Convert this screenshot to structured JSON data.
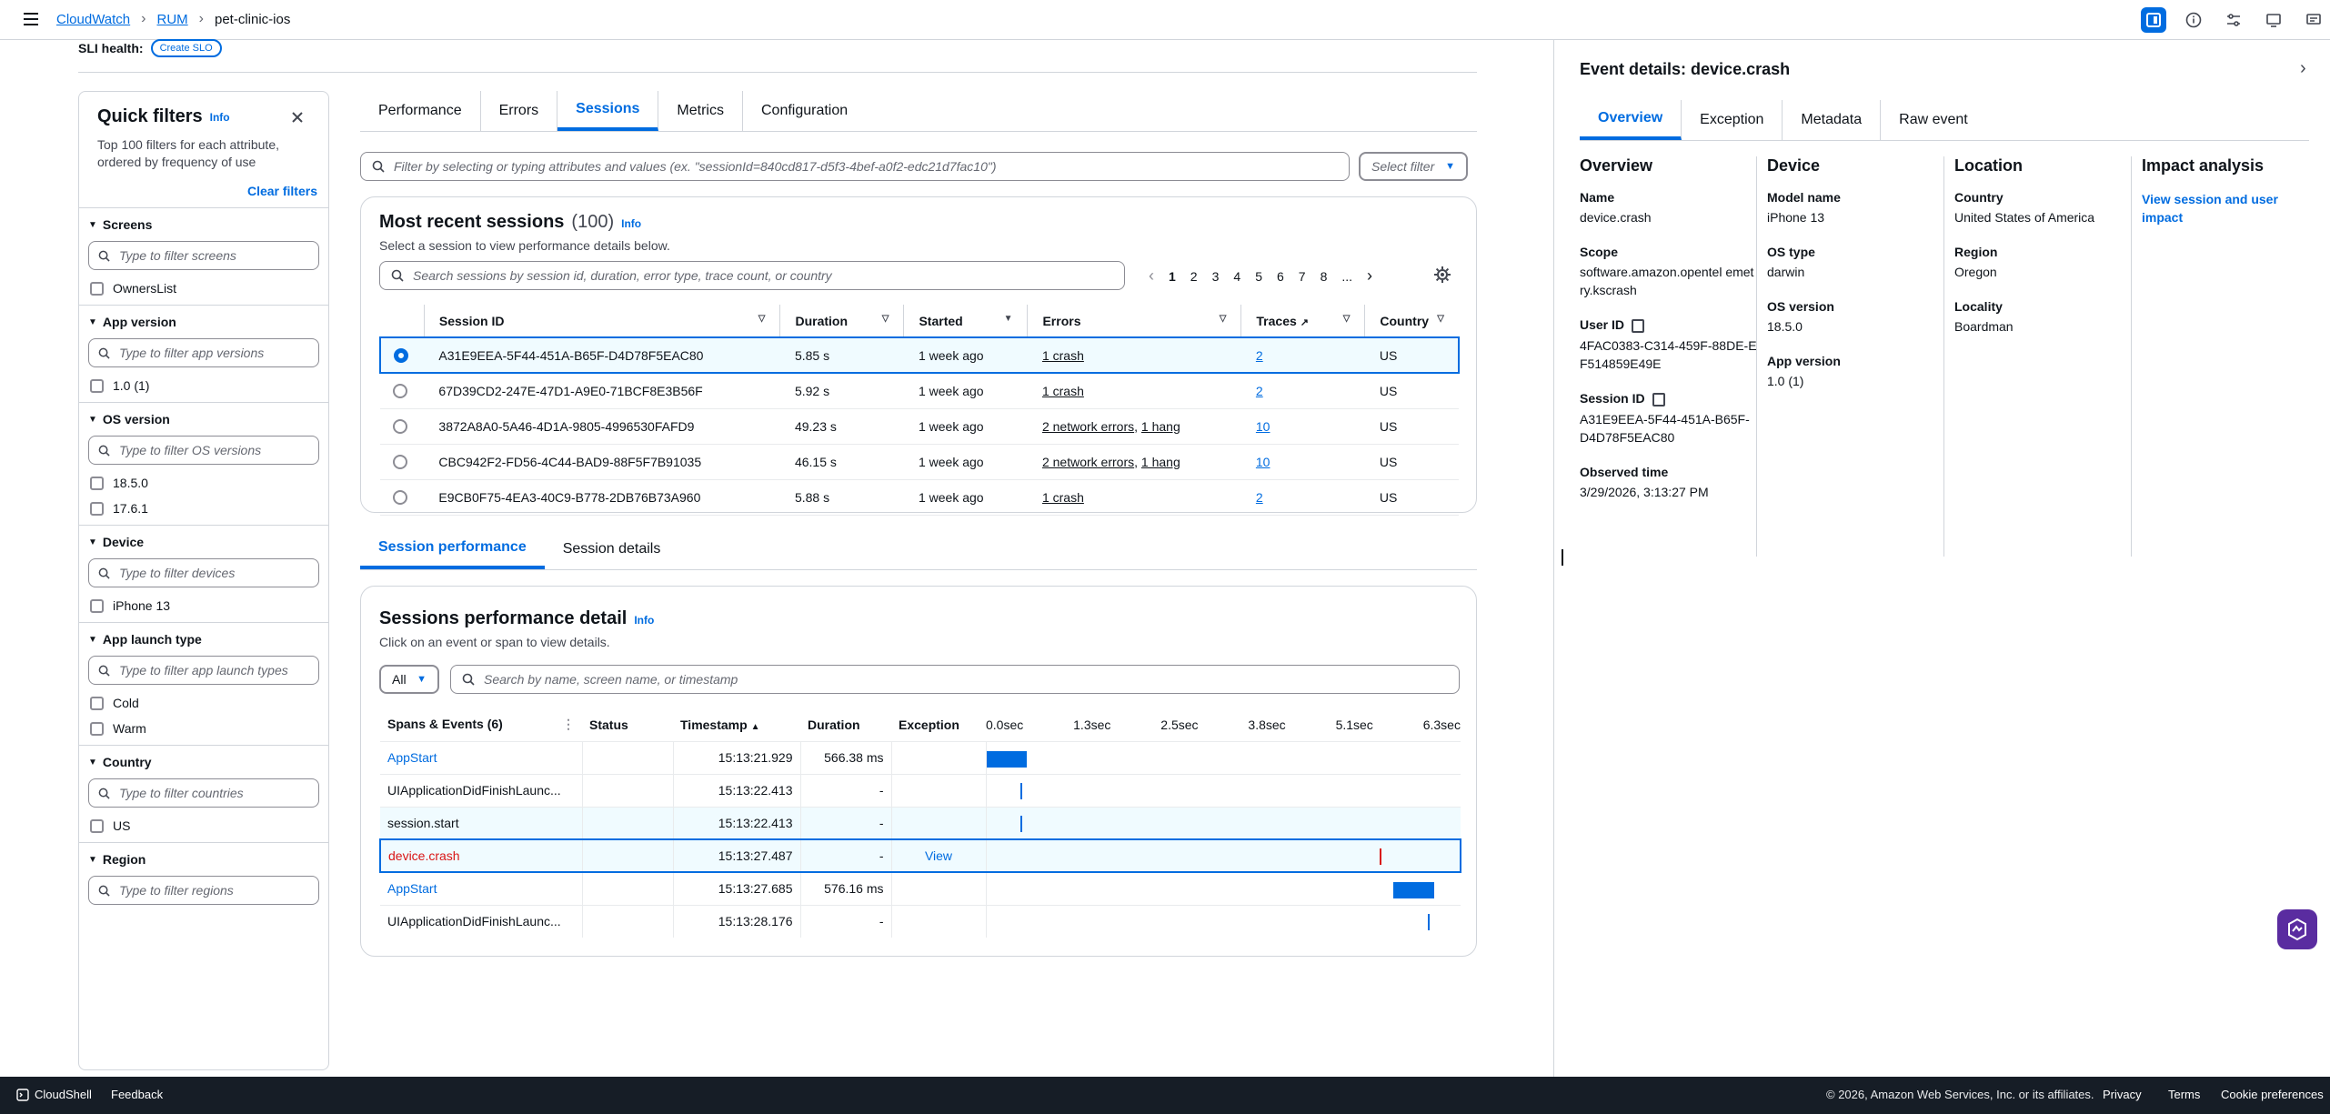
{
  "breadcrumbs": [
    "CloudWatch",
    "RUM",
    "pet-clinic-ios"
  ],
  "sli": {
    "label": "SLI health:",
    "button": "Create SLO"
  },
  "quick_filters": {
    "title": "Quick filters",
    "info": "Info",
    "description": "Top 100 filters for each attribute, ordered by frequency of use",
    "clear": "Clear filters",
    "sections": [
      {
        "title": "Screens",
        "placeholder": "Type to filter screens",
        "options": [
          "OwnersList"
        ]
      },
      {
        "title": "App version",
        "placeholder": "Type to filter app versions",
        "options": [
          "1.0 (1)"
        ]
      },
      {
        "title": "OS version",
        "placeholder": "Type to filter OS versions",
        "options": [
          "18.5.0",
          "17.6.1"
        ]
      },
      {
        "title": "Device",
        "placeholder": "Type to filter devices",
        "options": [
          "iPhone 13"
        ]
      },
      {
        "title": "App launch type",
        "placeholder": "Type to filter app launch types",
        "options": [
          "Cold",
          "Warm"
        ]
      },
      {
        "title": "Country",
        "placeholder": "Type to filter countries",
        "options": [
          "US"
        ]
      },
      {
        "title": "Region",
        "placeholder": "Type to filter regions",
        "options": []
      }
    ]
  },
  "main_tabs": [
    "Performance",
    "Errors",
    "Sessions",
    "Metrics",
    "Configuration"
  ],
  "filter": {
    "placeholder": "Filter by selecting or typing attributes and values (ex. \"sessionId=840cd817-d5f3-4bef-a0f2-edc21d7fac10\")",
    "select": "Select filter"
  },
  "sessions": {
    "title": "Most recent sessions",
    "count": "(100)",
    "info": "Info",
    "subtitle": "Select a session to view performance details below.",
    "search_placeholder": "Search sessions by session id, duration, error type, trace count, or country",
    "pages": [
      "1",
      "2",
      "3",
      "4",
      "5",
      "6",
      "7",
      "8",
      "..."
    ],
    "columns": [
      "Session ID",
      "Duration",
      "Started",
      "Errors",
      "Traces",
      "Country"
    ],
    "rows": [
      {
        "id": "A31E9EEA-5F44-451A-B65F-D4D78F5EAC80",
        "duration": "5.85 s",
        "started": "1 week ago",
        "errors": [
          "1 crash"
        ],
        "traces": "2",
        "country": "US"
      },
      {
        "id": "67D39CD2-247E-47D1-A9E0-71BCF8E3B56F",
        "duration": "5.92 s",
        "started": "1 week ago",
        "errors": [
          "1 crash"
        ],
        "traces": "2",
        "country": "US"
      },
      {
        "id": "3872A8A0-5A46-4D1A-9805-4996530FAFD9",
        "duration": "49.23 s",
        "started": "1 week ago",
        "errors": [
          "2 network errors",
          "1 hang"
        ],
        "traces": "10",
        "country": "US"
      },
      {
        "id": "CBC942F2-FD56-4C44-BAD9-88F5F7B91035",
        "duration": "46.15 s",
        "started": "1 week ago",
        "errors": [
          "2 network errors",
          "1 hang"
        ],
        "traces": "10",
        "country": "US"
      },
      {
        "id": "E9CB0F75-4EA3-40C9-B778-2DB76B73A960",
        "duration": "5.88 s",
        "started": "1 week ago",
        "errors": [
          "1 crash"
        ],
        "traces": "2",
        "country": "US"
      }
    ]
  },
  "session_tabs": [
    "Session performance",
    "Session details"
  ],
  "perf": {
    "title": "Sessions performance detail",
    "info": "Info",
    "subtitle": "Click on an event or span to view details.",
    "all": "All",
    "search_placeholder": "Search by name, screen name, or timestamp",
    "columns": [
      "Spans & Events (6)",
      "Status",
      "Timestamp",
      "Duration",
      "Exception"
    ],
    "ticks": [
      "0.0sec",
      "1.3sec",
      "2.5sec",
      "3.8sec",
      "5.1sec",
      "6.3sec"
    ],
    "rows": [
      {
        "name": "AppStart",
        "link": true,
        "crash": false,
        "timestamp": "15:13:21.929",
        "duration": "566.38 ms",
        "exception": "",
        "start": 0.0,
        "length": 0.566
      },
      {
        "name": "UIApplicationDidFinishLaunc...",
        "link": false,
        "crash": false,
        "timestamp": "15:13:22.413",
        "duration": "-",
        "exception": "",
        "start": 0.484,
        "length": 0
      },
      {
        "name": "session.start",
        "link": false,
        "crash": false,
        "timestamp": "15:13:22.413",
        "duration": "-",
        "exception": "",
        "start": 0.484,
        "length": 0
      },
      {
        "name": "device.crash",
        "link": false,
        "crash": true,
        "timestamp": "15:13:27.487",
        "duration": "-",
        "exception": "View",
        "start": 5.558,
        "length": 0
      },
      {
        "name": "AppStart",
        "link": true,
        "crash": false,
        "timestamp": "15:13:27.685",
        "duration": "576.16 ms",
        "exception": "",
        "start": 5.756,
        "length": 0.576
      },
      {
        "name": "UIApplicationDidFinishLaunc...",
        "link": false,
        "crash": false,
        "timestamp": "15:13:28.176",
        "duration": "-",
        "exception": "",
        "start": 6.247,
        "length": 0
      }
    ]
  },
  "event": {
    "title": "Event details: device.crash",
    "tabs": [
      "Overview",
      "Exception",
      "Metadata",
      "Raw event"
    ],
    "overview": {
      "heading": "Overview",
      "items": [
        {
          "k": "Name",
          "v": "device.crash"
        },
        {
          "k": "Scope",
          "v": "software.amazon.opentel emetry.kscrash"
        },
        {
          "k": "User ID",
          "v": "4FAC0383-C314-459F-88DE-EF514859E49E"
        },
        {
          "k": "Session ID",
          "v": "A31E9EEA-5F44-451A-B65F-D4D78F5EAC80"
        },
        {
          "k": "Observed time",
          "v": "3/29/2026, 3:13:27 PM"
        }
      ]
    },
    "device": {
      "heading": "Device",
      "items": [
        {
          "k": "Model name",
          "v": "iPhone 13"
        },
        {
          "k": "OS type",
          "v": "darwin"
        },
        {
          "k": "OS version",
          "v": "18.5.0"
        },
        {
          "k": "App version",
          "v": "1.0 (1)"
        }
      ]
    },
    "location": {
      "heading": "Location",
      "items": [
        {
          "k": "Country",
          "v": "United States of America"
        },
        {
          "k": "Region",
          "v": "Oregon"
        },
        {
          "k": "Locality",
          "v": "Boardman"
        }
      ]
    },
    "impact": {
      "heading": "Impact analysis",
      "link": "View session and user impact"
    }
  },
  "footer": {
    "cloudshell": "CloudShell",
    "feedback": "Feedback",
    "copyright": "© 2026, Amazon Web Services, Inc. or its affiliates.",
    "links": [
      "Privacy",
      "Terms",
      "Cookie preferences"
    ]
  },
  "colors": {
    "accent": "#006ce0",
    "crash": "#d91515",
    "footer": "#161d26"
  }
}
